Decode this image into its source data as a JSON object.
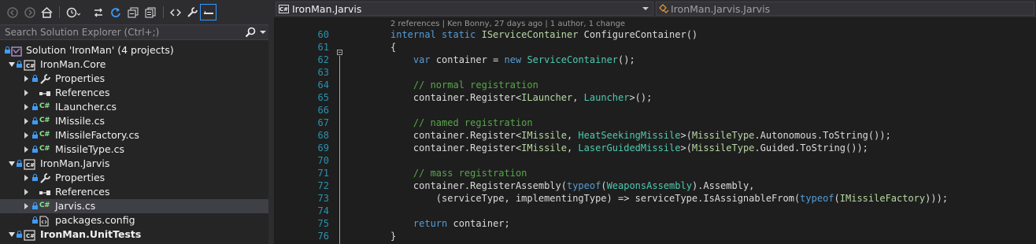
{
  "solution_explorer": {
    "search_placeholder": "Search Solution Explorer (Ctrl+;)",
    "toolbar_icons": [
      "back-arrow-icon",
      "forward-arrow-icon",
      "home-icon",
      "history-icon",
      "sync-icon",
      "refresh-icon",
      "collapse-all-icon",
      "show-all-files-icon",
      "code-view-icon",
      "properties-wrench-icon",
      "preview-pin-icon"
    ],
    "tree": [
      {
        "label": "Solution 'IronMan' (4 projects)",
        "kind": "solution",
        "expanded": null,
        "bold": false
      },
      {
        "label": "IronMan.Core",
        "kind": "project",
        "expanded": true,
        "bold": false
      },
      {
        "label": "Properties",
        "kind": "properties",
        "expanded": false,
        "bold": false
      },
      {
        "label": "References",
        "kind": "references",
        "expanded": false,
        "bold": false
      },
      {
        "label": "ILauncher.cs",
        "kind": "csfile",
        "expanded": false,
        "bold": false
      },
      {
        "label": "IMissile.cs",
        "kind": "csfile",
        "expanded": false,
        "bold": false
      },
      {
        "label": "IMissileFactory.cs",
        "kind": "csfile",
        "expanded": false,
        "bold": false
      },
      {
        "label": "MissileType.cs",
        "kind": "csfile",
        "expanded": false,
        "bold": false
      },
      {
        "label": "IronMan.Jarvis",
        "kind": "project",
        "expanded": true,
        "bold": false
      },
      {
        "label": "Properties",
        "kind": "properties",
        "expanded": false,
        "bold": false
      },
      {
        "label": "References",
        "kind": "references",
        "expanded": false,
        "bold": false
      },
      {
        "label": "Jarvis.cs",
        "kind": "csfile",
        "expanded": false,
        "bold": false,
        "selected": true
      },
      {
        "label": "packages.config",
        "kind": "config",
        "expanded": null,
        "bold": false
      },
      {
        "label": "IronMan.UnitTests",
        "kind": "project",
        "expanded": true,
        "bold": true
      }
    ]
  },
  "editor": {
    "nav_project": "IronMan.Jarvis",
    "nav_class": "IronMan.Jarvis.Jarvis",
    "codelens": "2 references | Ken Bonny, 27 days ago | 1 author, 1 change",
    "line_numbers": [
      "60",
      "61",
      "62",
      "63",
      "64",
      "65",
      "66",
      "67",
      "68",
      "69",
      "70",
      "71",
      "72",
      "73",
      "74",
      "75",
      "76"
    ],
    "lines": [
      [
        {
          "t": "internal static ",
          "c": "kw"
        },
        {
          "t": "IServiceContainer",
          "c": "iface"
        },
        {
          "t": " ConfigureContainer()",
          "c": ""
        }
      ],
      [
        {
          "t": "{",
          "c": ""
        }
      ],
      [
        {
          "t": "    ",
          "c": ""
        },
        {
          "t": "var",
          "c": "kw"
        },
        {
          "t": " container = ",
          "c": ""
        },
        {
          "t": "new",
          "c": "kw"
        },
        {
          "t": " ",
          "c": ""
        },
        {
          "t": "ServiceContainer",
          "c": "ty"
        },
        {
          "t": "();",
          "c": ""
        }
      ],
      [
        {
          "t": "",
          "c": ""
        }
      ],
      [
        {
          "t": "    // normal registration",
          "c": "cm"
        }
      ],
      [
        {
          "t": "    container.Register<",
          "c": ""
        },
        {
          "t": "ILauncher",
          "c": "iface"
        },
        {
          "t": ", ",
          "c": ""
        },
        {
          "t": "Launcher",
          "c": "ty"
        },
        {
          "t": ">();",
          "c": ""
        }
      ],
      [
        {
          "t": "",
          "c": ""
        }
      ],
      [
        {
          "t": "    // named registration",
          "c": "cm"
        }
      ],
      [
        {
          "t": "    container.Register<",
          "c": ""
        },
        {
          "t": "IMissile",
          "c": "iface"
        },
        {
          "t": ", ",
          "c": ""
        },
        {
          "t": "HeatSeekingMissile",
          "c": "ty"
        },
        {
          "t": ">(",
          "c": ""
        },
        {
          "t": "MissileType",
          "c": "iface"
        },
        {
          "t": ".Autonomous.ToString());",
          "c": ""
        }
      ],
      [
        {
          "t": "    container.Register<",
          "c": ""
        },
        {
          "t": "IMissile",
          "c": "iface"
        },
        {
          "t": ", ",
          "c": ""
        },
        {
          "t": "LaserGuidedMissile",
          "c": "ty"
        },
        {
          "t": ">(",
          "c": ""
        },
        {
          "t": "MissileType",
          "c": "iface"
        },
        {
          "t": ".Guided.ToString());",
          "c": ""
        }
      ],
      [
        {
          "t": "",
          "c": ""
        }
      ],
      [
        {
          "t": "    // mass registration",
          "c": "cm"
        }
      ],
      [
        {
          "t": "    container.RegisterAssembly(",
          "c": ""
        },
        {
          "t": "typeof",
          "c": "kw"
        },
        {
          "t": "(",
          "c": ""
        },
        {
          "t": "WeaponsAssembly",
          "c": "ty"
        },
        {
          "t": ").Assembly,",
          "c": ""
        }
      ],
      [
        {
          "t": "        (serviceType, implementingType) => serviceType.IsAssignableFrom(",
          "c": ""
        },
        {
          "t": "typeof",
          "c": "kw"
        },
        {
          "t": "(",
          "c": ""
        },
        {
          "t": "IMissileFactory",
          "c": "iface"
        },
        {
          "t": ")));",
          "c": ""
        }
      ],
      [
        {
          "t": "",
          "c": ""
        }
      ],
      [
        {
          "t": "    ",
          "c": ""
        },
        {
          "t": "return",
          "c": "kw"
        },
        {
          "t": " container;",
          "c": ""
        }
      ],
      [
        {
          "t": "}",
          "c": ""
        }
      ]
    ]
  },
  "colors": {
    "keyword": "#569cd6",
    "type": "#4ec9b0",
    "interface": "#b8d7a3",
    "comment": "#57a64a",
    "line_number": "#2b91af"
  }
}
